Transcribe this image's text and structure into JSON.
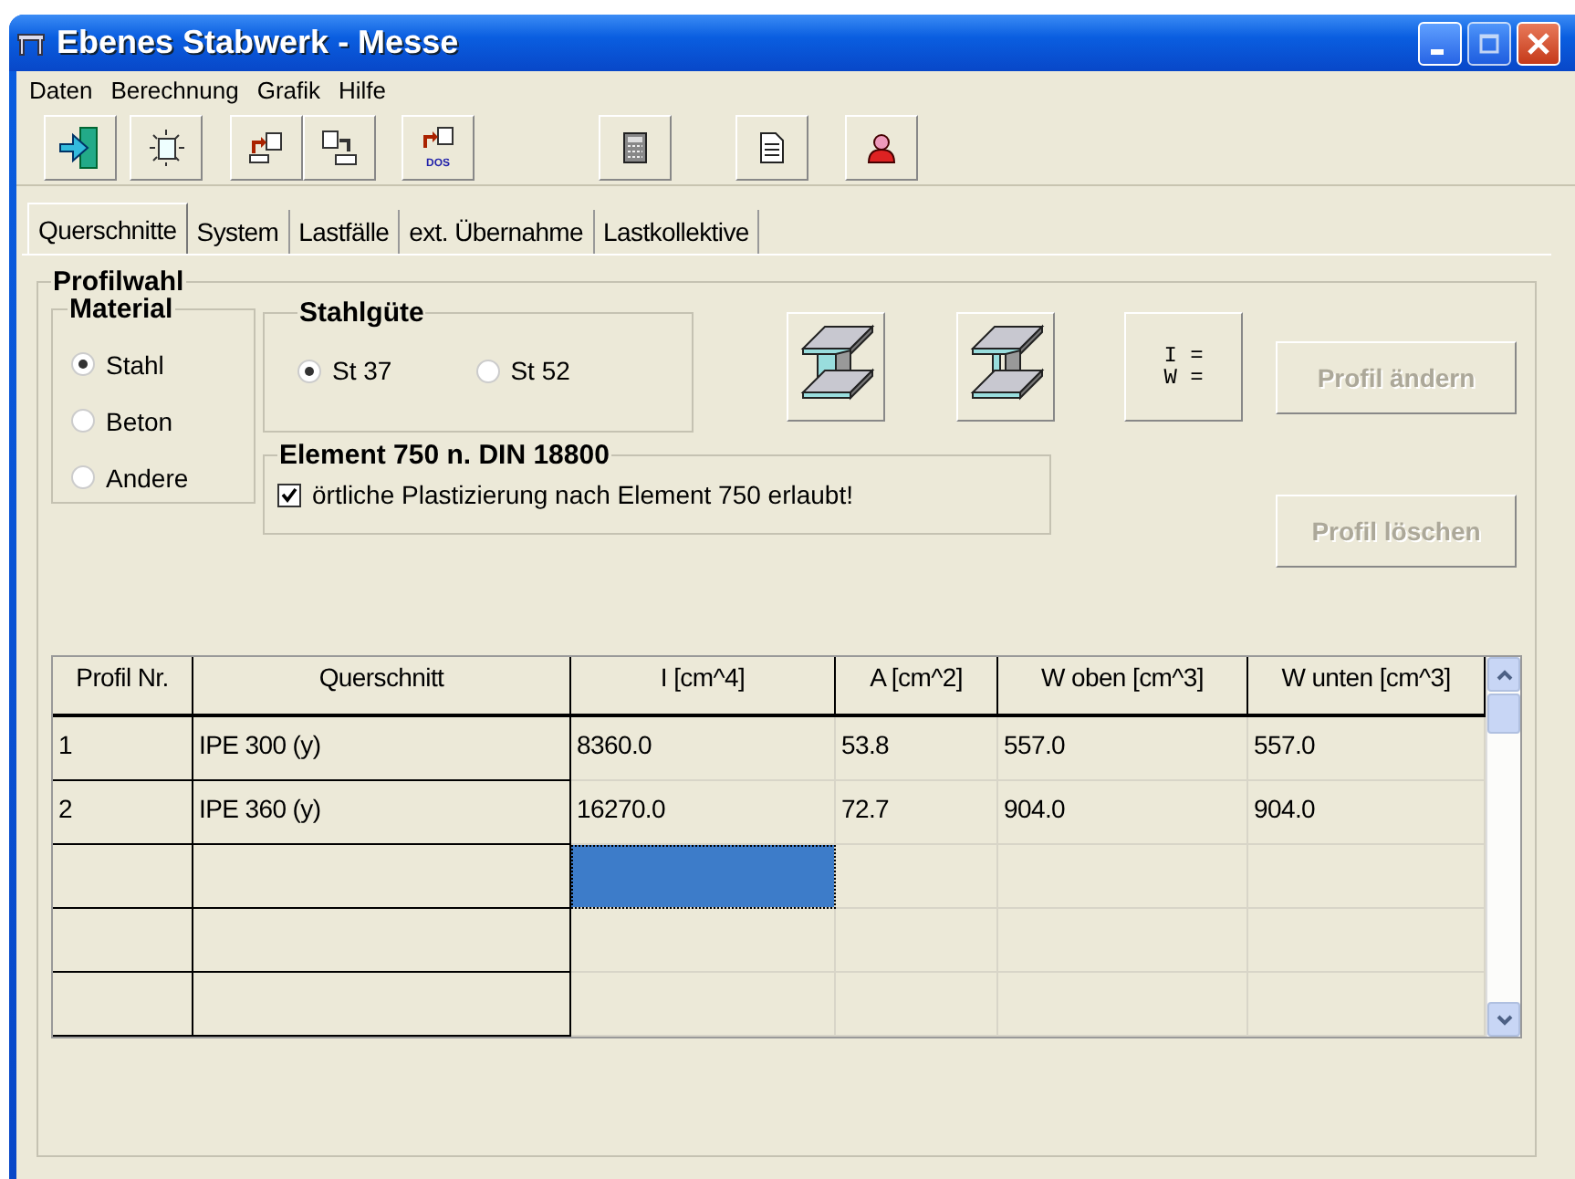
{
  "window": {
    "title": "Ebenes Stabwerk - Messe"
  },
  "menu": [
    "Daten",
    "Berechnung",
    "Grafik",
    "Hilfe"
  ],
  "toolbar": [
    {
      "kind": "exit"
    },
    {
      "kind": "new"
    },
    {
      "kind": "export"
    },
    {
      "kind": "import"
    },
    {
      "kind": "dos",
      "label": "DOS"
    },
    {
      "kind": "calculator"
    },
    {
      "kind": "document"
    },
    {
      "kind": "user"
    }
  ],
  "tabs": [
    {
      "label": "Querschnitte",
      "selected": true
    },
    {
      "label": "System",
      "selected": false
    },
    {
      "label": "Lastfälle",
      "selected": false
    },
    {
      "label": "ext. Übernahme",
      "selected": false
    },
    {
      "label": "Lastkollektive",
      "selected": false
    }
  ],
  "profilwahl": {
    "title": "Profilwahl",
    "material": {
      "title": "Material",
      "options": [
        {
          "label": "Stahl",
          "selected": true
        },
        {
          "label": "Beton",
          "selected": false
        },
        {
          "label": "Andere",
          "selected": false
        }
      ]
    },
    "stahlguete": {
      "title": "Stahlgüte",
      "options": [
        {
          "label": "St 37",
          "selected": true
        },
        {
          "label": "St 52",
          "selected": false
        }
      ]
    },
    "shape_buttons": [
      {
        "kind": "i-beam-rolled"
      },
      {
        "kind": "i-beam-welded"
      },
      {
        "kind": "formula",
        "lines": [
          "I =",
          "W ="
        ]
      }
    ],
    "element": {
      "title": "Element 750 n. DIN 18800",
      "checkbox": {
        "label": "örtliche Plastizierung nach Element 750 erlaubt!",
        "checked": true
      }
    },
    "buttons": [
      {
        "label": "Profil ändern",
        "disabled": true
      },
      {
        "label": "Profil löschen",
        "disabled": true
      }
    ]
  },
  "table": {
    "columns": [
      "Profil Nr.",
      "Querschnitt",
      "I [cm^4]",
      "A [cm^2]",
      "W oben  [cm^3]",
      "W unten [cm^3]"
    ],
    "rows": [
      {
        "cells": [
          {
            "text": "1",
            "selected": false
          },
          {
            "text": "IPE 300 (y)",
            "selected": false
          },
          {
            "text": "8360.0",
            "selected": false
          },
          {
            "text": "53.8",
            "selected": false
          },
          {
            "text": "557.0",
            "selected": false
          },
          {
            "text": "557.0",
            "selected": false
          }
        ]
      },
      {
        "cells": [
          {
            "text": "2",
            "selected": false
          },
          {
            "text": "IPE 360 (y)",
            "selected": false
          },
          {
            "text": "16270.0",
            "selected": false
          },
          {
            "text": "72.7",
            "selected": false
          },
          {
            "text": "904.0",
            "selected": false
          },
          {
            "text": "904.0",
            "selected": false
          }
        ]
      },
      {
        "cells": [
          {
            "selected": false
          },
          {
            "selected": false
          },
          {
            "selected": true
          },
          {
            "selected": false
          },
          {
            "selected": false
          },
          {
            "selected": false
          }
        ]
      },
      {
        "cells": [
          {
            "selected": false
          },
          {
            "selected": false
          },
          {
            "selected": false
          },
          {
            "selected": false
          },
          {
            "selected": false
          },
          {
            "selected": false
          }
        ]
      },
      {
        "cells": [
          {
            "selected": false
          },
          {
            "selected": false
          },
          {
            "selected": false
          },
          {
            "selected": false
          },
          {
            "selected": false
          },
          {
            "selected": false
          }
        ]
      }
    ]
  }
}
